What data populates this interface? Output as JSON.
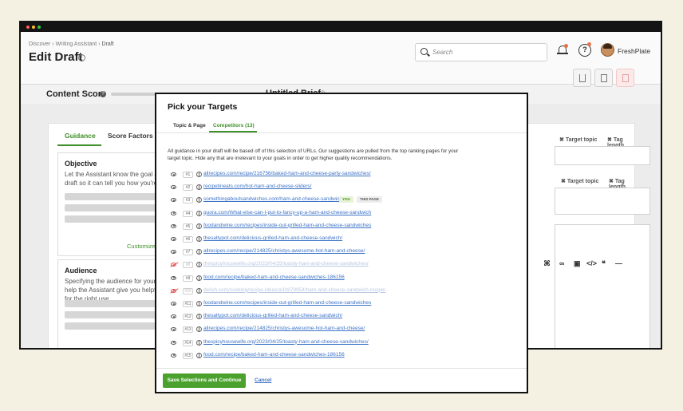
{
  "breadcrumb": {
    "items": [
      "Discover",
      "Writing Assistant",
      "Draft"
    ]
  },
  "page": {
    "title": "Edit Draft"
  },
  "search": {
    "placeholder": "Search"
  },
  "account": {
    "name": "FreshPlate"
  },
  "score": {
    "label": "Content Score",
    "brief_title": "Untitled Brief"
  },
  "tabs": {
    "guidance": "Guidance",
    "score_factors": "Score Factors"
  },
  "objective": {
    "title": "Objective",
    "text": "Let the Assistant know the goal of your draft so it can tell you how you're doing.",
    "customize": "Customize"
  },
  "audience": {
    "title": "Audience",
    "text": "Specifying the audience for your draft will help the Assistant give you helpful content for the right use"
  },
  "right_tags": {
    "target_topic": "Target topic",
    "tag_length": "Tag length"
  },
  "modal": {
    "title": "Pick your Targets",
    "tab_topic": "Topic & Page",
    "tab_competitors": "Competitors (13)",
    "description": "All guidance in your draft will be based off of this selection of URLs. Our suggestions are pulled from the top ranking pages for your target topic. Hide any that are irrelevant to your goals in order to get higher quality recommendations.",
    "you_label": "YOU",
    "this_page_label": "THIS PAGE",
    "save_label": "Save Selections and Continue",
    "cancel_label": "Cancel",
    "urls": [
      {
        "num": "#1",
        "url": "allrecipes.com/recipe/216756/baked-ham-and-cheese-party-sandwiches/",
        "hidden": false
      },
      {
        "num": "#2",
        "url": "recipetineats.com/hot-ham-and-cheese-sliders/",
        "hidden": false
      },
      {
        "num": "#3",
        "url": "somethingaboutsandwiches.com/ham-and-cheese-sandwich/",
        "hidden": false
      },
      {
        "num": "#4",
        "url": "quora.com/What-else-can-I-put-to-fancy-up-a-ham-and-cheese-sandwich",
        "hidden": false
      },
      {
        "num": "#5",
        "url": "foodandwine.com/recipes/inside-out-grilled-ham-and-cheese-sandwiches",
        "hidden": false
      },
      {
        "num": "#6",
        "url": "thesaltypot.com/delicious-grilled-ham-and-cheese-sandwich/",
        "hidden": false
      },
      {
        "num": "#7",
        "url": "allrecipes.com/recipe/214825/christys-awesome-hot-ham-and-cheese/",
        "hidden": false
      },
      {
        "num": "#8",
        "url": "thespicyhousewife.org/2023/04/25/toasty-ham-and-cheese-sandwiches/",
        "hidden": true
      },
      {
        "num": "#9",
        "url": "food.com/recipe/baked-ham-and-cheese-sandwiches-186156",
        "hidden": false
      },
      {
        "num": "#10",
        "url": "delish.com/cooking/recipe-ideas/a30879954/ham-and-cheese-sandwich-recipe/",
        "hidden": true
      },
      {
        "num": "#11",
        "url": "foodandwine.com/recipes/inside-out-grilled-ham-and-cheese-sandwiches",
        "hidden": false
      },
      {
        "num": "#12",
        "url": "thesaltypot.com/delicious-grilled-ham-and-cheese-sandwich/",
        "hidden": false
      },
      {
        "num": "#13",
        "url": "allrecipes.com/recipe/214825/christys-awesome-hot-ham-and-cheese/",
        "hidden": false
      },
      {
        "num": "#14",
        "url": "thespicyhousewife.org/2023/04/25/toasty-ham-and-cheese-sandwiches/",
        "hidden": false
      },
      {
        "num": "#15",
        "url": "food.com/recipe/baked-ham-and-cheese-sandwiches-186156",
        "hidden": false
      }
    ]
  },
  "colors": {
    "accent": "#4aa12d",
    "link": "#3d73c6",
    "hidden_eye": "#e05050"
  }
}
